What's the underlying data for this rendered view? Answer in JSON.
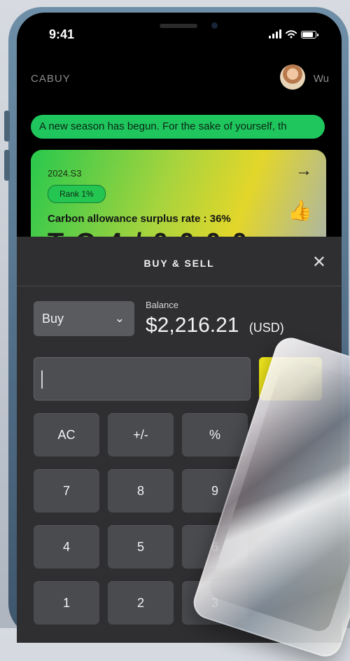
{
  "status": {
    "time": "9:41"
  },
  "header": {
    "brand": "CABUY",
    "username": "Wu"
  },
  "announcement": {
    "text": "A new season has begun. For the sake of yourself, th"
  },
  "season_card": {
    "season": "2024.S3",
    "rank": "Rank 1%",
    "surplus_label": "Carbon allowance surplus rate : 36%",
    "partial_value": "T O 4 / 0 0 0 0"
  },
  "buy_sell_panel": {
    "title": "BUY & SELL",
    "mode": "Buy",
    "balance_label": "Balance",
    "balance_amount": "$2,216.21",
    "balance_currency": "(USD)",
    "amount_input_value": ""
  },
  "keypad": {
    "keys": [
      {
        "label": "AC"
      },
      {
        "label": "+/-"
      },
      {
        "label": "%"
      },
      {
        "label": "7"
      },
      {
        "label": "8"
      },
      {
        "label": "9"
      },
      {
        "label": "4"
      },
      {
        "label": "5"
      },
      {
        "label": "6"
      },
      {
        "label": "1"
      },
      {
        "label": "2"
      },
      {
        "label": "3"
      }
    ]
  },
  "icons": {
    "arrow": "right-arrow-icon",
    "thumb": "thumbs-up-icon",
    "close": "close-icon",
    "chevron": "chevron-down-icon",
    "wifi": "wifi-icon",
    "battery": "battery-icon"
  },
  "colors": {
    "accent_green": "#1fc65d",
    "accent_yellow": "#f2e91c",
    "panel_bg": "#2f2f31"
  }
}
